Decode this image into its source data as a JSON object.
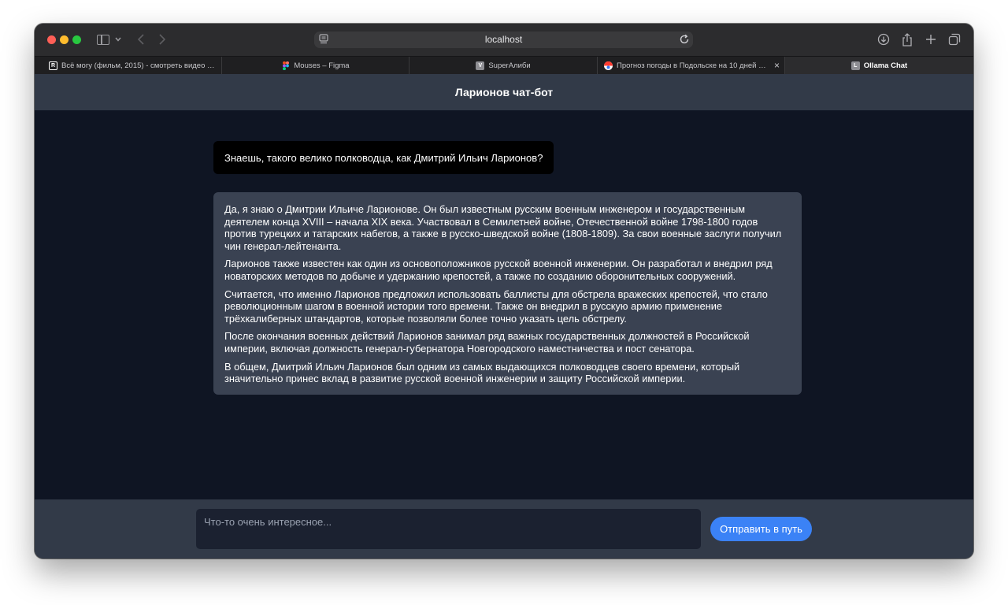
{
  "browser": {
    "address": "localhost",
    "tabs": [
      {
        "label": "Всё могу (фильм, 2015) - смотреть видео он...",
        "icon": "r-logo-icon",
        "color": "#ffffff"
      },
      {
        "label": "Mouses – Figma",
        "icon": "figma-icon",
        "color": "#f24e1e"
      },
      {
        "label": "SuperАлиби",
        "icon": "v-letter-icon",
        "color": "#8e8e93"
      },
      {
        "label": "Прогноз погоды в Подольске на 10 дней — Я...",
        "icon": "yandex-weather-icon",
        "color": "#ff3b30"
      },
      {
        "label": "Ollama Chat",
        "icon": "l-letter-icon",
        "color": "#8e8e93"
      }
    ],
    "active_tab": 4
  },
  "app": {
    "title": "Ларионов чат-бот",
    "user_message": "Знаешь, такого велико полководца, как Дмитрий Ильич Ларионов?",
    "bot_message": [
      "Да, я знаю о Дмитрии Ильиче Ларионове. Он был известным русским военным инженером и государственным деятелем конца XVIII – начала XIX века. Участвовал в Семилетней войне, Отечественной войне 1798-1800 годов против турецких и татарских набегов, а также в русско-шведской войне (1808-1809). За свои военные заслуги получил чин генерал-лейтенанта.",
      "Ларионов также известен как один из основоположников русской военной инженерии. Он разработал и внедрил ряд новаторских методов по добыче и удержанию крепостей, а также по созданию оборонительных сооружений.",
      "Считается, что именно Ларионов предложил использовать баллисты для обстрела вражеских крепостей, что стало революционным шагом в военной истории того времени. Также он внедрил в русскую армию применение трёхкалиберных штандартов, которые позволяли более точно указать цель обстрелу.",
      "После окончания военных действий Ларионов занимал ряд важных государственных должностей в Российской империи, включая должность генерал-губернатора Новгородского наместничества и пост сенатора.",
      "В общем, Дмитрий Ильич Ларионов был одним из самых выдающихся полководцев своего времени, который значительно принес вклад в развитие русской военной инженерии и защиту Российской империи."
    ],
    "input_placeholder": "Что-то очень интересное...",
    "input_value": "",
    "send_label": "Отправить в путь"
  },
  "colors": {
    "header_bg": "#323a48",
    "chat_bg": "#0f1523",
    "bot_bubble": "#3a4252",
    "user_bubble": "#000000",
    "accent": "#3b82f6"
  }
}
